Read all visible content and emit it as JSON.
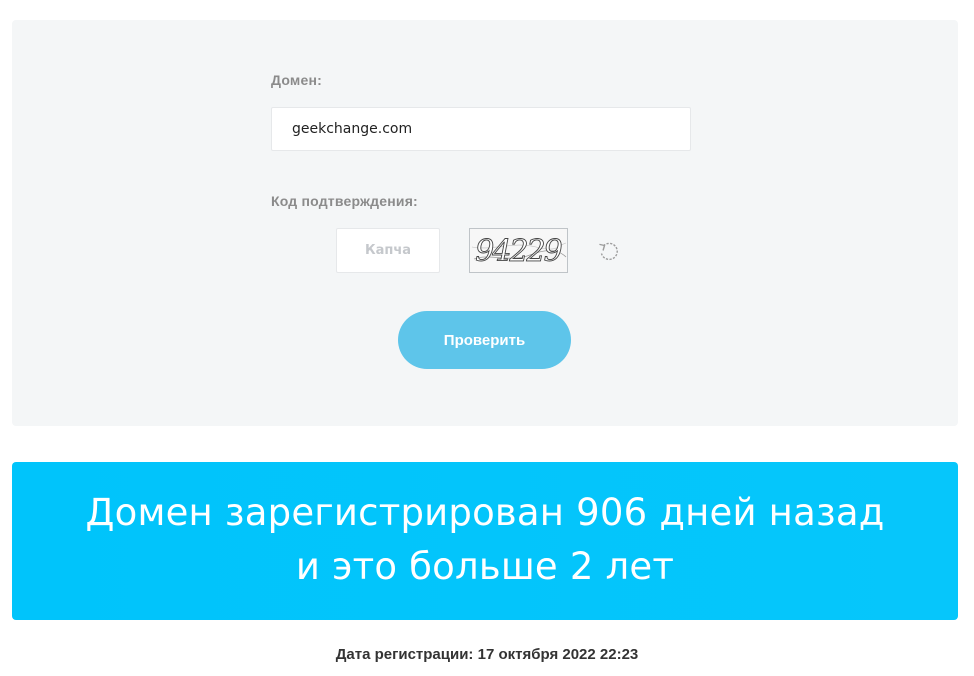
{
  "form": {
    "domain_label": "Домен:",
    "domain_value": "geekchange.com",
    "code_label": "Код подтверждения:",
    "captcha_placeholder": "Капча",
    "captcha_text": "94229",
    "refresh_icon": "refresh-icon",
    "submit_label": "Проверить",
    "colors": {
      "panel_bg": "#f4f6f7",
      "button_bg": "#5ec5ea"
    }
  },
  "result": {
    "line1": "Домен зарегистрирован 906 дней назад",
    "line2": "и это больше 2 лет",
    "color": "#00c4fb",
    "registration_date_label": "Дата регистрации: 17 октября 2022 22:23"
  }
}
